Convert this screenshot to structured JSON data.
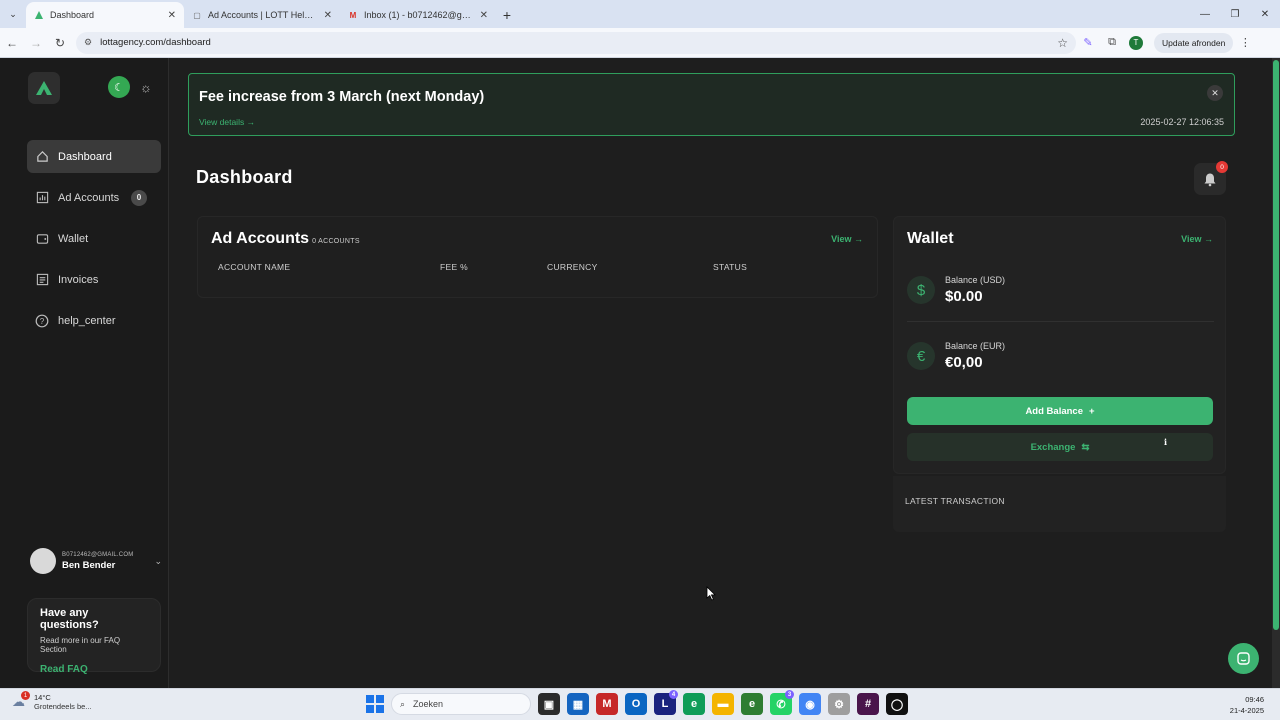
{
  "browser": {
    "tabs": [
      {
        "title": "Dashboard",
        "active": true,
        "icon": "lott-logo-icon"
      },
      {
        "title": "Ad Accounts | LOTT Help Cente",
        "active": false,
        "icon": "help-center-icon"
      },
      {
        "title": "Inbox (1) - b0712462@gmail.co",
        "active": false,
        "icon": "gmail-icon"
      }
    ],
    "url": "lottagency.com/dashboard",
    "profile_initial": "T",
    "update_label": "Update afronden"
  },
  "banner": {
    "title": "Fee increase from 3 March (next Monday)",
    "details_label": "View details →",
    "timestamp": "2025-02-27 12:06:35"
  },
  "sidebar": {
    "items": [
      {
        "label": "Dashboard",
        "icon": "home-icon",
        "active": true
      },
      {
        "label": "Ad Accounts",
        "icon": "bar-chart-icon",
        "badge": "0"
      },
      {
        "label": "Wallet",
        "icon": "wallet-icon"
      },
      {
        "label": "Invoices",
        "icon": "invoice-icon"
      },
      {
        "label": "help_center",
        "icon": "help-circle-icon"
      }
    ],
    "user": {
      "email": "B0712462@GMAIL.COM",
      "name": "Ben Bender"
    },
    "faq": {
      "question": "Have any questions?",
      "subtitle": "Read more in our FAQ Section",
      "link": "Read FAQ"
    }
  },
  "main": {
    "title": "Dashboard",
    "notifications_count": "0",
    "accounts": {
      "title": "Ad Accounts",
      "count_label": "0 ACCOUNTS",
      "view_label": "View →",
      "columns": [
        "ACCOUNT NAME",
        "FEE %",
        "CURRENCY",
        "STATUS"
      ]
    },
    "wallet": {
      "title": "Wallet",
      "view_label": "View →",
      "balances": [
        {
          "label": "Balance (USD)",
          "amount": "$0.00",
          "icon": "$"
        },
        {
          "label": "Balance (EUR)",
          "amount": "€0,00",
          "icon": "€"
        }
      ],
      "add_balance_label": "Add Balance",
      "exchange_label": "Exchange",
      "info": "i"
    },
    "latest": {
      "title": "LATEST TRANSACTION"
    }
  },
  "taskbar": {
    "weather_temp": "14°C",
    "weather_desc": "Grotendeels be...",
    "weather_badge": "1",
    "search_placeholder": "Zoeken",
    "time": "09:46",
    "date": "21-4-2025"
  },
  "colors": {
    "accent": "#3cb371",
    "background": "#1e1e1e",
    "danger": "#e53935"
  }
}
